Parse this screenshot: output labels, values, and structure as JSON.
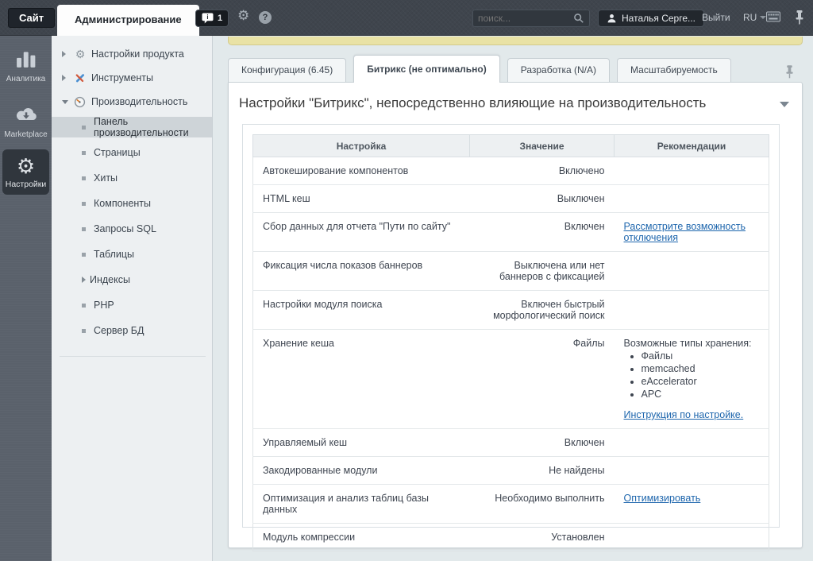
{
  "topbar": {
    "site_tab": "Сайт",
    "admin_tab": "Администрирование",
    "notifications": {
      "icon": "notification-bubble-icon",
      "count": "1"
    },
    "search": {
      "placeholder": "поиск...",
      "icon": "search-icon"
    },
    "user": {
      "icon": "user-icon",
      "name": "Наталья Серге..."
    },
    "logout_label": "Выйти",
    "language": "RU"
  },
  "left_rail": {
    "items": [
      {
        "label": "Аналитика",
        "icon": "bar-chart-icon",
        "active": false
      },
      {
        "label": "Marketplace",
        "icon": "cloud-download-icon",
        "active": false
      },
      {
        "label": "Настройки",
        "icon": "gear-icon",
        "active": true
      }
    ]
  },
  "sidebar": {
    "items": [
      {
        "label": "Настройки продукта",
        "icon": "product-gear-icon",
        "arrow": "collapsed",
        "level": 0
      },
      {
        "label": "Инструменты",
        "icon": "tools-icon",
        "arrow": "collapsed",
        "level": 0
      },
      {
        "label": "Производительность",
        "icon": "gauge-icon",
        "arrow": "expanded",
        "level": 0
      },
      {
        "label": "Панель производительности",
        "level": 1,
        "bullet": true,
        "selected": true
      },
      {
        "label": "Страницы",
        "level": 1,
        "bullet": true
      },
      {
        "label": "Хиты",
        "level": 1,
        "bullet": true
      },
      {
        "label": "Компоненты",
        "level": 1,
        "bullet": true
      },
      {
        "label": "Запросы SQL",
        "level": 1,
        "bullet": true
      },
      {
        "label": "Таблицы",
        "level": 1,
        "bullet": true
      },
      {
        "label": "Индексы",
        "level": 1,
        "arrow": "collapsed"
      },
      {
        "label": "PHP",
        "level": 1,
        "bullet": true
      },
      {
        "label": "Сервер БД",
        "level": 1,
        "bullet": true
      }
    ]
  },
  "content": {
    "tabs": [
      {
        "label": "Конфигурация (6.45)",
        "active": false
      },
      {
        "label": "Битрикс (не оптимально)",
        "active": true
      },
      {
        "label": "Разработка (N/A)",
        "active": false
      },
      {
        "label": "Масштабируемость",
        "active": false
      }
    ],
    "heading": "Настройки \"Битрикс\", непосредственно влияющие на производительность",
    "table": {
      "headers": [
        "Настройка",
        "Значение",
        "Рекомендации"
      ],
      "rows": [
        {
          "setting": "Автокеширование компонентов",
          "value": "Включено",
          "recommendation": []
        },
        {
          "setting": "HTML кеш",
          "value": "Выключен",
          "recommendation": []
        },
        {
          "setting": "Сбор данных для отчета \"Пути по сайту\"",
          "value": "Включен",
          "recommendation": [
            {
              "type": "link",
              "text": "Рассмотрите возможность отключения"
            }
          ]
        },
        {
          "setting": "Фиксация числа показов баннеров",
          "value": "Выключена или нет баннеров с фиксацией",
          "recommendation": []
        },
        {
          "setting": "Настройки модуля поиска",
          "value": "Включен быстрый морфологический поиск",
          "recommendation": []
        },
        {
          "setting": "Хранение кеша",
          "value": "Файлы",
          "recommendation": [
            {
              "type": "text",
              "text": "Возможные типы хранения:"
            },
            {
              "type": "list",
              "items": [
                "Файлы",
                "memcached",
                "eAccelerator",
                "APC"
              ]
            },
            {
              "type": "link",
              "text": "Инструкция по настройке."
            }
          ]
        },
        {
          "setting": "Управляемый кеш",
          "value": "Включен",
          "recommendation": []
        },
        {
          "setting": "Закодированные модули",
          "value": "Не найдены",
          "recommendation": []
        },
        {
          "setting": "Оптимизация и анализ таблиц базы данных",
          "value": "Необходимо выполнить",
          "recommendation": [
            {
              "type": "link",
              "text": "Оптимизировать"
            }
          ]
        },
        {
          "setting": "Модуль компрессии",
          "value": "Установлен",
          "recommendation": []
        }
      ]
    }
  },
  "colors": {
    "topbar_bg": "#3f454d",
    "rail_bg": "#5a616b",
    "sidebar_bg": "#edf0f2",
    "sidebar_selected": "#ced4d8",
    "content_bg": "#e2e9eb",
    "notice_strip": "#e9e2a5",
    "link": "#1e66ad"
  }
}
